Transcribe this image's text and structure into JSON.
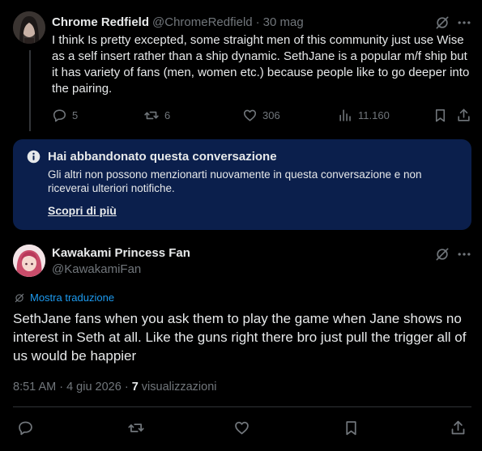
{
  "reply": {
    "author_name": "Chrome Redfield",
    "author_handle": "@ChromeRedfield",
    "date": "30 mag",
    "text": "I think Is pretty excepted, some straight men of this community just use Wise as a self insert rather than a ship dynamic. SethJane is a popular m/f ship but it has variety of fans (men, women etc.) because people like to go deeper into the pairing.",
    "replies": "5",
    "reposts": "6",
    "likes": "306",
    "views": "11.160"
  },
  "notice": {
    "title": "Hai abbandonato questa conversazione",
    "text": "Gli altri non possono menzionarti nuovamente in questa conversazione e non riceverai ulteriori notifiche.",
    "link": "Scopri di più"
  },
  "main": {
    "author_name": "Kawakami Princess Fan",
    "author_handle": "@KawakamiFan",
    "translate_label": "Mostra traduzione",
    "text": "SethJane fans when you ask them to play the game when Jane shows no interest in Seth at all. Like the guns right there bro just pull the trigger all of us would be happier",
    "timestamp": "8:51 AM · 4 giu 2026 · ",
    "views_count": "7",
    "views_label": " visualizzazioni"
  },
  "colors": {
    "background": "#000000",
    "text": "#e7e9ea",
    "muted": "#71767b",
    "accent": "#1d9bf0",
    "notice_bg": "#0b1f4c"
  },
  "icons": [
    "grok-icon",
    "more-icon",
    "reply-icon",
    "repost-icon",
    "like-icon",
    "views-icon",
    "bookmark-icon",
    "share-icon",
    "info-icon",
    "translate-icon"
  ]
}
